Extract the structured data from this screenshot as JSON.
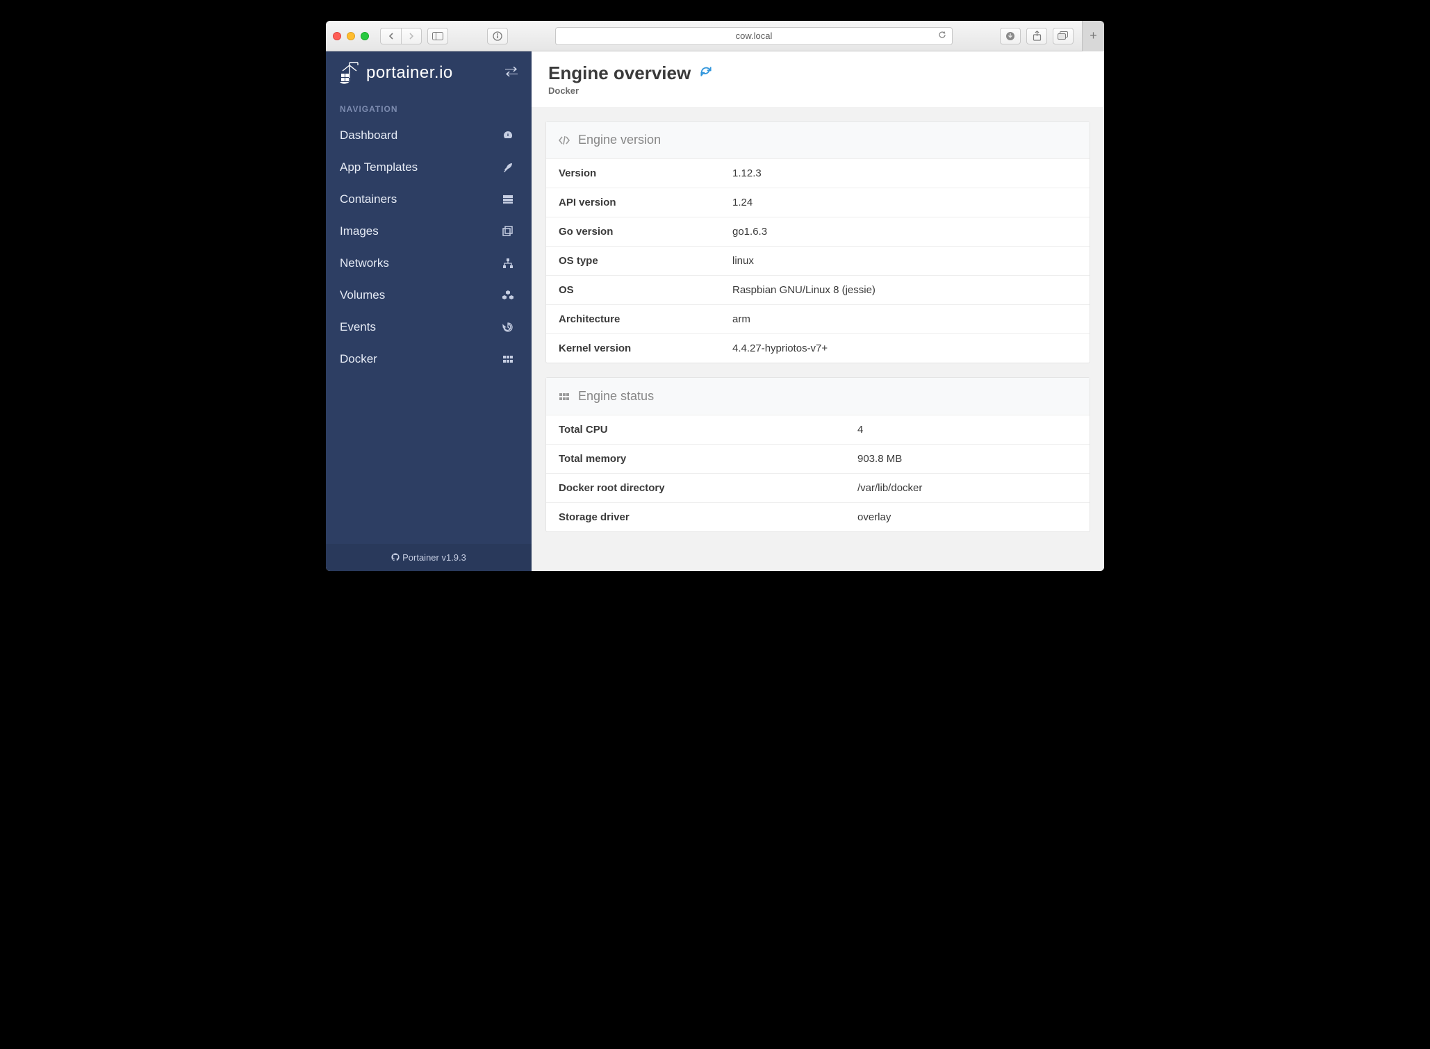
{
  "browser": {
    "url": "cow.local"
  },
  "brand": {
    "name": "portainer.io"
  },
  "sidebar": {
    "section_label": "NAVIGATION",
    "items": [
      {
        "label": "Dashboard"
      },
      {
        "label": "App Templates"
      },
      {
        "label": "Containers"
      },
      {
        "label": "Images"
      },
      {
        "label": "Networks"
      },
      {
        "label": "Volumes"
      },
      {
        "label": "Events"
      },
      {
        "label": "Docker"
      }
    ],
    "footer": "Portainer v1.9.3"
  },
  "page": {
    "title": "Engine overview",
    "subtitle": "Docker"
  },
  "panels": {
    "engine_version": {
      "title": "Engine version",
      "rows": [
        {
          "label": "Version",
          "value": "1.12.3"
        },
        {
          "label": "API version",
          "value": "1.24"
        },
        {
          "label": "Go version",
          "value": "go1.6.3"
        },
        {
          "label": "OS type",
          "value": "linux"
        },
        {
          "label": "OS",
          "value": "Raspbian GNU/Linux 8 (jessie)"
        },
        {
          "label": "Architecture",
          "value": "arm"
        },
        {
          "label": "Kernel version",
          "value": "4.4.27-hypriotos-v7+"
        }
      ]
    },
    "engine_status": {
      "title": "Engine status",
      "rows": [
        {
          "label": "Total CPU",
          "value": "4"
        },
        {
          "label": "Total memory",
          "value": "903.8 MB"
        },
        {
          "label": "Docker root directory",
          "value": "/var/lib/docker"
        },
        {
          "label": "Storage driver",
          "value": "overlay"
        }
      ]
    }
  }
}
